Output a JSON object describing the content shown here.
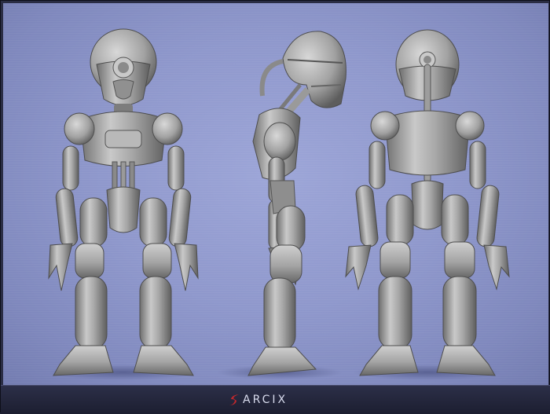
{
  "image": {
    "subject": "robot-character-turnaround",
    "views": [
      "front-view",
      "side-view",
      "back-view"
    ],
    "colors": {
      "background": "#8f98cc",
      "model": "#a9a9a9",
      "footer": "#242640",
      "brand_mark": "#c0282d"
    }
  },
  "footer": {
    "brand_name": "ARCIX"
  }
}
